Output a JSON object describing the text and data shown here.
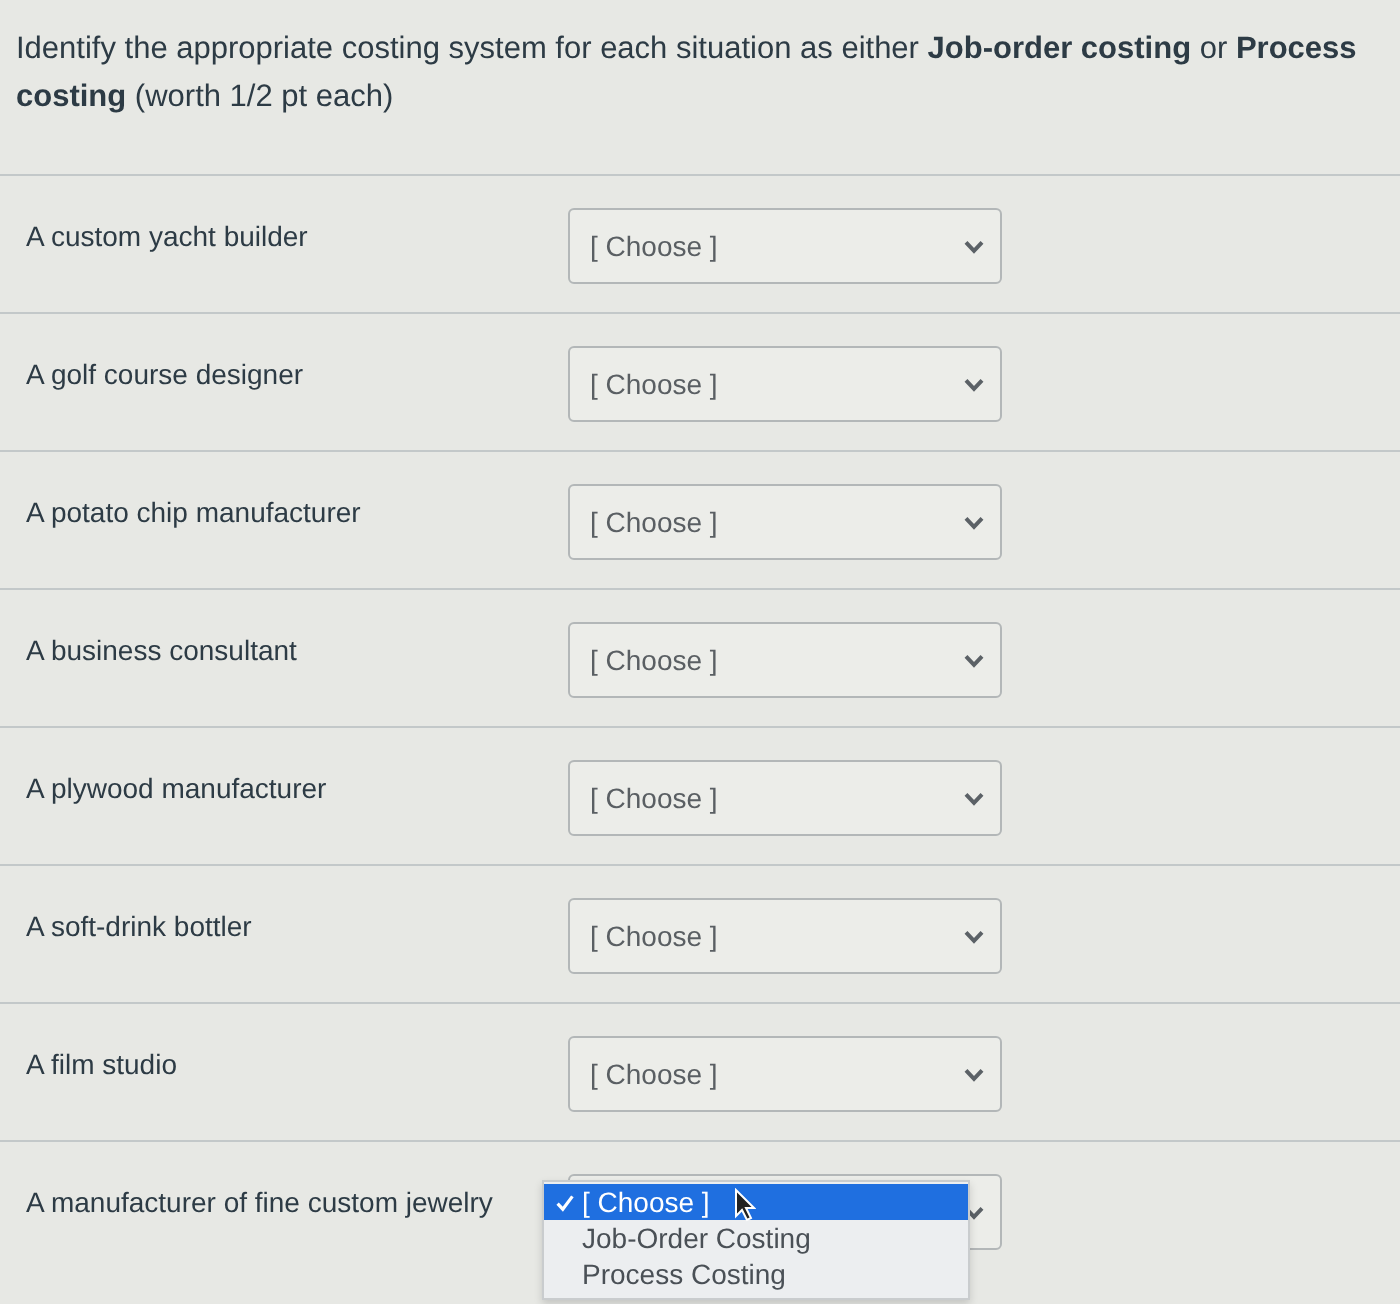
{
  "instruction": "Identify the appropriate costing system for each situation as either **Job-order costing** or **Process costing** (worth 1/2 pt each)",
  "items": [
    {
      "situation": "A custom yacht builder",
      "answer": "[ Choose ]",
      "expanded": false
    },
    {
      "situation": "A golf course designer",
      "answer": "[ Choose ]",
      "expanded": false
    },
    {
      "situation": "A potato chip manufacturer",
      "answer": "[ Choose ]",
      "expanded": false
    },
    {
      "situation": "A business consultant",
      "answer": "[ Choose ]",
      "expanded": false
    },
    {
      "situation": "A plywood manufacturer",
      "answer": "[ Choose ]",
      "expanded": false
    },
    {
      "situation": "A soft-drink bottler",
      "answer": "[ Choose ]",
      "expanded": false
    },
    {
      "situation": "A film studio",
      "answer": "[ Choose ]",
      "expanded": false
    },
    {
      "situation": "A manufacturer of fine custom jewelry",
      "expanded": true,
      "options": [
        {
          "label": "[ Choose ]",
          "selected": true
        },
        {
          "label": "Job-Order Costing",
          "selected": false
        },
        {
          "label": "Process Costing",
          "selected": false
        }
      ]
    }
  ]
}
